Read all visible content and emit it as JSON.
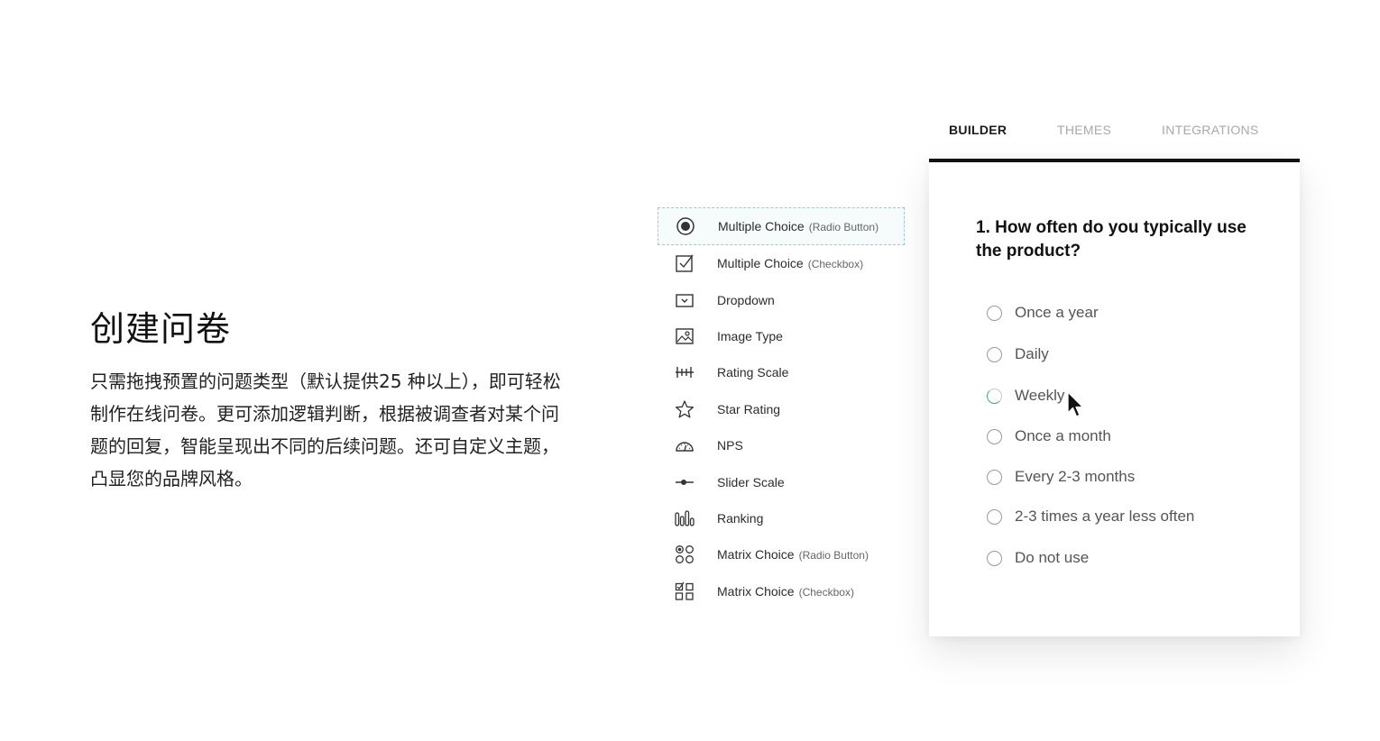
{
  "hero": {
    "title": "创建问卷",
    "description": "只需拖拽预置的问题类型（默认提供25 种以上），即可轻松制作在线问卷。更可添加逻辑判断，根据被调查者对某个问题的回复，智能呈现出不同的后续问题。还可自定义主题，凸显您的品牌风格。"
  },
  "tabs": [
    {
      "label": "BUILDER",
      "active": true
    },
    {
      "label": "THEMES",
      "active": false
    },
    {
      "label": "INTEGRATIONS",
      "active": false
    }
  ],
  "question_types": [
    {
      "label": "Multiple Choice",
      "sub": "(Radio Button)",
      "icon": "radio-button-icon",
      "selected": true
    },
    {
      "label": "Multiple Choice",
      "sub": "(Checkbox)",
      "icon": "checkbox-icon"
    },
    {
      "label": "Dropdown",
      "sub": "",
      "icon": "dropdown-icon"
    },
    {
      "label": "Image Type",
      "sub": "",
      "icon": "image-icon"
    },
    {
      "label": "Rating Scale",
      "sub": "",
      "icon": "rating-scale-icon"
    },
    {
      "label": "Star Rating",
      "sub": "",
      "icon": "star-icon"
    },
    {
      "label": "NPS",
      "sub": "",
      "icon": "gauge-icon"
    },
    {
      "label": "Slider Scale",
      "sub": "",
      "icon": "slider-icon"
    },
    {
      "label": "Ranking",
      "sub": "",
      "icon": "ranking-icon"
    },
    {
      "label": "Matrix Choice",
      "sub": "(Radio Button)",
      "icon": "matrix-radio-icon"
    },
    {
      "label": "Matrix Choice",
      "sub": "(Checkbox)",
      "icon": "matrix-checkbox-icon"
    }
  ],
  "survey": {
    "question_number": "1.",
    "question_text": "How often do you typically use the product?",
    "options": [
      {
        "label": "Once a year",
        "state": "unselected"
      },
      {
        "label": "Daily",
        "state": "unselected"
      },
      {
        "label": "Weekly",
        "state": "selecting"
      },
      {
        "label": "Once a month",
        "state": "unselected"
      },
      {
        "label": "Every 2-3 months",
        "state": "unselected"
      },
      {
        "label": "2-3 times a year less often",
        "state": "unselected"
      },
      {
        "label": "Do not use",
        "state": "unselected"
      }
    ]
  },
  "colors": {
    "card_border": "#111111",
    "selected_outline": "#9fc9cf",
    "loading_accent": "#3aa876"
  }
}
